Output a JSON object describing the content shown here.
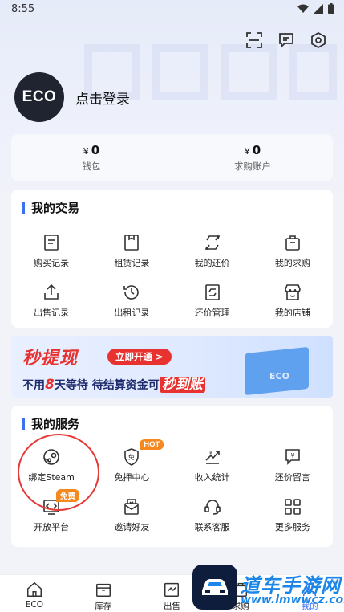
{
  "status": {
    "time": "8:55"
  },
  "profile": {
    "avatar_text": "ECO",
    "login_text": "点击登录"
  },
  "wallet": [
    {
      "currency": "¥",
      "amount": "0",
      "label": "钱包"
    },
    {
      "currency": "¥",
      "amount": "0",
      "label": "求购账户"
    }
  ],
  "trade": {
    "title": "我的交易",
    "items": [
      {
        "label": "购买记录",
        "icon": "receipt-icon"
      },
      {
        "label": "租赁记录",
        "icon": "rent-doc-icon"
      },
      {
        "label": "我的还价",
        "icon": "exchange-icon"
      },
      {
        "label": "我的求购",
        "icon": "bag-icon"
      },
      {
        "label": "出售记录",
        "icon": "upload-icon"
      },
      {
        "label": "出租记录",
        "icon": "history-icon"
      },
      {
        "label": "还价管理",
        "icon": "exchange-frame-icon"
      },
      {
        "label": "我的店铺",
        "icon": "shop-icon"
      }
    ]
  },
  "banner": {
    "title": "秒提现",
    "button": "立即开通 >",
    "sub_pre": "不用",
    "sub_num": "8",
    "sub_mid": "天等待 待结算资金可",
    "sub_big": "秒到账",
    "box_label": "ECO"
  },
  "services": {
    "title": "我的服务",
    "items": [
      {
        "label": "绑定Steam",
        "icon": "steam-icon",
        "badge": ""
      },
      {
        "label": "免押中心",
        "icon": "deposit-free-icon",
        "badge": "HOT"
      },
      {
        "label": "收入统计",
        "icon": "income-chart-icon",
        "badge": ""
      },
      {
        "label": "还价留言",
        "icon": "message-icon",
        "badge": ""
      },
      {
        "label": "开放平台",
        "icon": "code-icon",
        "badge": "免费"
      },
      {
        "label": "邀请好友",
        "icon": "invite-icon",
        "badge": ""
      },
      {
        "label": "联系客服",
        "icon": "support-icon",
        "badge": ""
      },
      {
        "label": "更多服务",
        "icon": "grid-icon",
        "badge": ""
      }
    ]
  },
  "nav": [
    {
      "label": "ECO",
      "icon": "home-icon"
    },
    {
      "label": "库存",
      "icon": "inventory-icon"
    },
    {
      "label": "出售",
      "icon": "sell-icon"
    },
    {
      "label": "求购",
      "icon": "buy-icon"
    },
    {
      "label": "我的",
      "icon": "profile-icon"
    }
  ],
  "watermark": {
    "text": "道车手游网",
    "url": "www.lmwwcz.com"
  },
  "colors": {
    "accent": "#3a6ff6",
    "badge": "#f5881f",
    "banner_red": "#e8322f",
    "annotation": "#e53935"
  }
}
